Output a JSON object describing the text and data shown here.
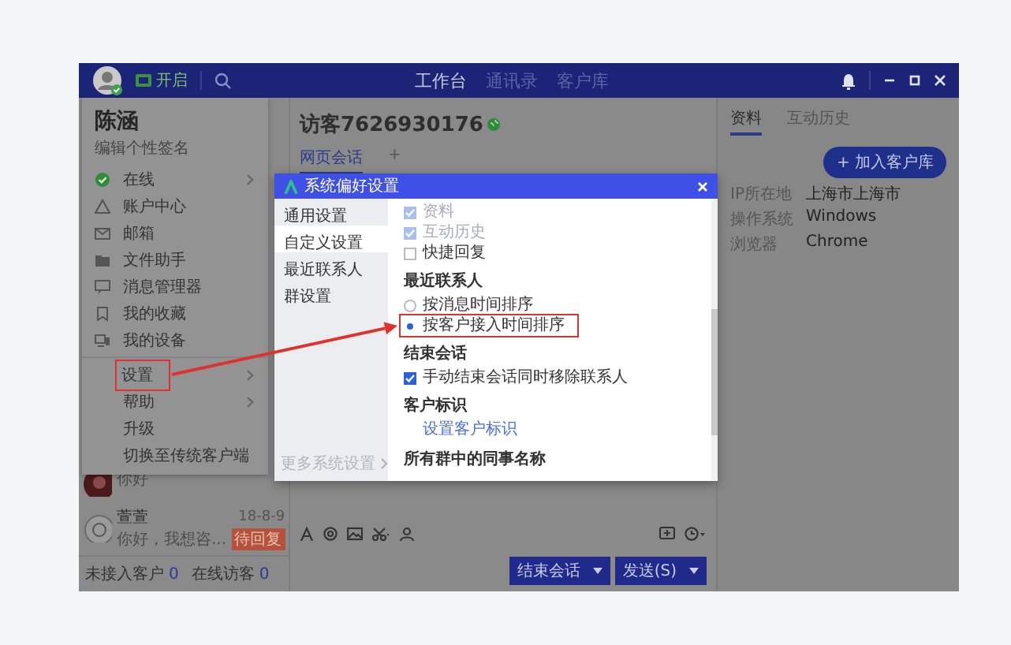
{
  "top_bar": {
    "status": "开启",
    "nav": [
      {
        "label": "工作台",
        "selected": true
      },
      {
        "label": "通讯录",
        "selected": false
      },
      {
        "label": "客户库",
        "selected": false
      }
    ]
  },
  "conversations": [
    {
      "preview": "你好"
    },
    {
      "name": "萱萱",
      "preview": "你好，我想咨...",
      "date": "18-8-9",
      "badge": "待回复"
    }
  ],
  "status_bar": [
    {
      "label": "未接入客户",
      "count": "0"
    },
    {
      "label": "在线访客",
      "count": "0"
    }
  ],
  "chat": {
    "title": "访客7626930176",
    "tabs": [
      {
        "label": "网页会话",
        "selected": true
      },
      {
        "label": "+",
        "selected": false
      }
    ],
    "buttons": [
      "结束会话",
      "发送(S)"
    ]
  },
  "info_panel": {
    "tabs": [
      {
        "label": "资料",
        "selected": true
      },
      {
        "label": "互动历史",
        "selected": false
      }
    ],
    "add_button": "+ 加入客户库",
    "fields": [
      {
        "label": "IP所在地",
        "value": "上海市上海市"
      },
      {
        "label": "操作系统",
        "value": "Windows"
      },
      {
        "label": "浏览器",
        "value": "Chrome"
      }
    ]
  },
  "profile_menu": {
    "name": "陈涵",
    "signature": "编辑个性签名",
    "items": [
      {
        "label": "在线",
        "submenu": true,
        "highlighted": false
      },
      {
        "label": "账户中心",
        "submenu": false,
        "highlighted": false
      },
      {
        "label": "邮箱",
        "submenu": false,
        "highlighted": false
      },
      {
        "label": "文件助手",
        "submenu": false,
        "highlighted": false
      },
      {
        "label": "消息管理器",
        "submenu": false,
        "highlighted": false
      },
      {
        "label": "我的收藏",
        "submenu": false,
        "highlighted": false
      },
      {
        "label": "我的设备",
        "submenu": false,
        "highlighted": false
      },
      {
        "label": "设置",
        "submenu": true,
        "highlighted": true
      },
      {
        "label": "帮助",
        "submenu": true,
        "highlighted": false
      },
      {
        "label": "升级",
        "submenu": false,
        "highlighted": false
      },
      {
        "label": "切换至传统客户端",
        "submenu": false,
        "highlighted": false
      }
    ]
  },
  "dialog": {
    "title": "系统偏好设置",
    "nav": [
      {
        "label": "通用设置",
        "selected": false
      },
      {
        "label": "自定义设置",
        "selected": true
      },
      {
        "label": "最近联系人",
        "selected": false
      },
      {
        "label": "群设置",
        "selected": false
      }
    ],
    "footer": "更多系统设置",
    "sections": [
      {
        "items": [
          {
            "kind": "checkbox",
            "label": "资料",
            "checked": true,
            "disabled": true
          },
          {
            "kind": "checkbox",
            "label": "互动历史",
            "checked": true,
            "disabled": true
          },
          {
            "kind": "checkbox",
            "label": "快捷回复",
            "checked": false,
            "disabled": false
          }
        ]
      },
      {
        "heading": "最近联系人",
        "items": [
          {
            "kind": "radio",
            "label": "按消息时间排序",
            "selected": false,
            "highlighted": false
          },
          {
            "kind": "radio",
            "label": "按客户接入时间排序",
            "selected": true,
            "highlighted": true
          }
        ]
      },
      {
        "heading": "结束会话",
        "items": [
          {
            "kind": "checkbox",
            "label": "手动结束会话同时移除联系人",
            "checked": true,
            "disabled": false
          }
        ]
      },
      {
        "heading": "客户标识",
        "items": [
          {
            "kind": "link",
            "label": "设置客户标识"
          }
        ]
      },
      {
        "heading": "所有群中的同事名称"
      }
    ]
  }
}
